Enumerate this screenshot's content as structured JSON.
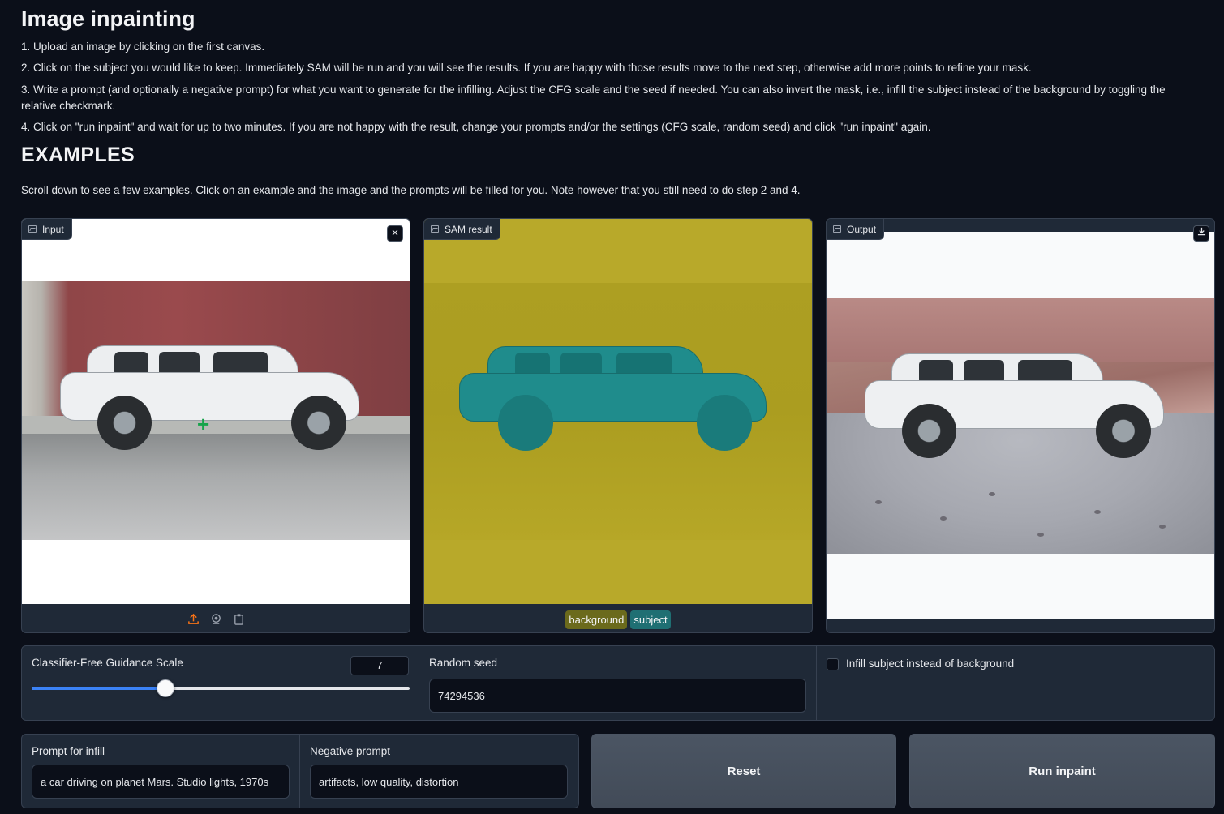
{
  "header": {
    "title": "Image inpainting",
    "steps": [
      "1. Upload an image by clicking on the first canvas.",
      "2. Click on the subject you would like to keep. Immediately SAM will be run and you will see the results. If you are happy with those results move to the next step, otherwise add more points to refine your mask.",
      "3. Write a prompt (and optionally a negative prompt) for what you want to generate for the infilling. Adjust the CFG scale and the seed if needed. You can also invert the mask, i.e., infill the subject instead of the background by toggling the relative checkmark.",
      "4. Click on \"run inpaint\" and wait for up to two minutes. If you are not happy with the result, change your prompts and/or the settings (CFG scale, random seed) and click \"run inpaint\" again."
    ],
    "examples_title": "EXAMPLES",
    "examples_note": "Scroll down to see a few examples. Click on an example and the image and the prompts will be filled for you. Note however that you still need to do step 2 and 4."
  },
  "panels": {
    "input": {
      "label": "Input",
      "close_icon": "close-icon",
      "toolbar_icons": [
        "upload-icon",
        "webcam-icon",
        "clipboard-icon"
      ]
    },
    "sam": {
      "label": "SAM result",
      "legend": [
        {
          "label": "background",
          "color": "#6b6a1c"
        },
        {
          "label": "subject",
          "color": "#1f6f73"
        }
      ]
    },
    "output": {
      "label": "Output",
      "download_icon": "download-icon"
    }
  },
  "controls": {
    "cfg": {
      "label": "Classifier-Free Guidance Scale",
      "value": "7",
      "fraction": 0.355
    },
    "seed": {
      "label": "Random seed",
      "value": "74294536"
    },
    "invert": {
      "label": "Infill subject instead of background",
      "checked": false
    }
  },
  "prompts": {
    "infill": {
      "label": "Prompt for infill",
      "value": "a car driving on planet Mars. Studio lights, 1970s"
    },
    "negative": {
      "label": "Negative prompt",
      "value": "artifacts, low quality, distortion"
    }
  },
  "buttons": {
    "reset": "Reset",
    "run": "Run inpaint"
  },
  "colors": {
    "background": "#0b0f19",
    "panel": "#1f2937",
    "accent": "#3b82f6",
    "sam_overlay": "#b8a92a",
    "subject_mask": "#1f8c8c"
  }
}
